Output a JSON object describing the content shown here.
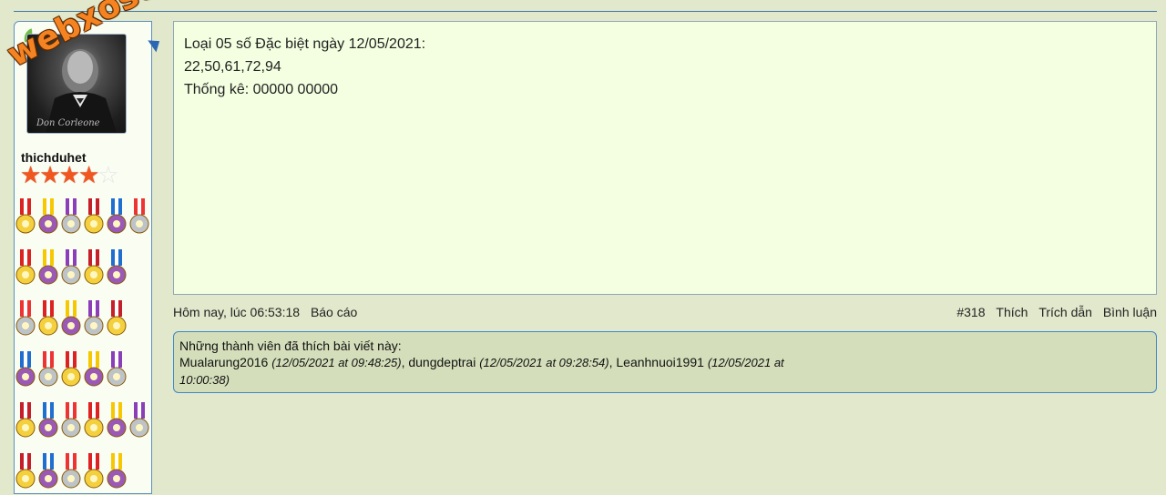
{
  "watermark": "webxoso.net",
  "user": {
    "name": "thichduhet",
    "rating_stars": 4,
    "max_stars": 5
  },
  "post": {
    "lines": [
      "Loại 05 số Đặc biệt ngày 12/05/2021:",
      "22,50,61,72,94",
      "Thống kê: 00000 00000"
    ],
    "timestamp": "Hôm nay, lúc 06:53:18",
    "report_label": "Báo cáo",
    "post_number": "#318",
    "like_label": "Thích",
    "quote_label": "Trích dẫn",
    "comment_label": "Bình luận"
  },
  "likes": {
    "header": "Những thành viên đã thích bài viết này:",
    "likers": [
      {
        "name": "Mualarung2016",
        "time": "(12/05/2021 at 09:48:25)"
      },
      {
        "name": "dungdeptrai",
        "time": "(12/05/2021 at 09:28:54)"
      },
      {
        "name": "Leanhnuoi1991",
        "time": "(12/05/2021 at 10:00:38)"
      }
    ]
  },
  "colors": {
    "page_bg": "#e1e8cb",
    "post_bg": "#f3ffe0",
    "likes_bg": "#d4deba",
    "accent_border": "#3f87c8",
    "star": "#f2561f",
    "watermark": "#f58322"
  }
}
